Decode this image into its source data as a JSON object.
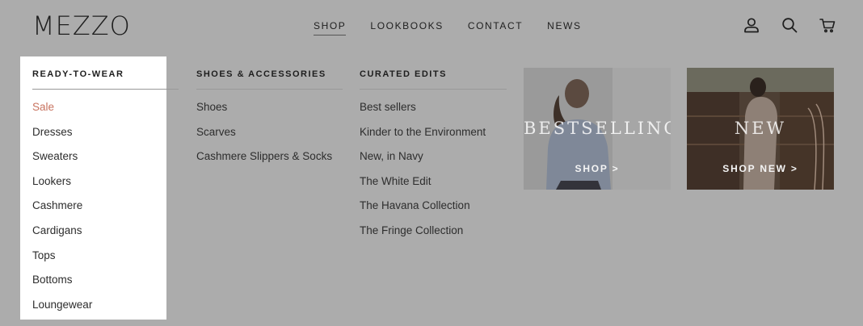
{
  "header": {
    "logo": "MEZZO",
    "nav": [
      "SHOP",
      "LOOKBOOKS",
      "CONTACT",
      "NEWS"
    ],
    "icons": [
      "account-icon",
      "search-icon",
      "cart-icon"
    ]
  },
  "menu": {
    "ready_to_wear": {
      "heading": "READY-TO-WEAR",
      "items": [
        "Sale",
        "Dresses",
        "Sweaters",
        "Lookers",
        "Cashmere",
        "Cardigans",
        "Tops",
        "Bottoms",
        "Loungewear"
      ]
    },
    "shoes_accessories": {
      "heading": "SHOES & ACCESSORIES",
      "items": [
        "Shoes",
        "Scarves",
        "Cashmere Slippers & Socks"
      ]
    },
    "curated_edits": {
      "heading": "CURATED EDITS",
      "items": [
        "Best sellers",
        "Kinder to the Environment",
        "New, in Navy",
        "The White Edit",
        "The Havana Collection",
        "The Fringe Collection"
      ]
    }
  },
  "promos": [
    {
      "title": "BESTSELLING",
      "cta": "SHOP >"
    },
    {
      "title": "NEW",
      "cta": "SHOP NEW >"
    }
  ],
  "colors": {
    "overlay": "#acacac",
    "sale": "#c8735f",
    "text": "#2d2d2d"
  }
}
